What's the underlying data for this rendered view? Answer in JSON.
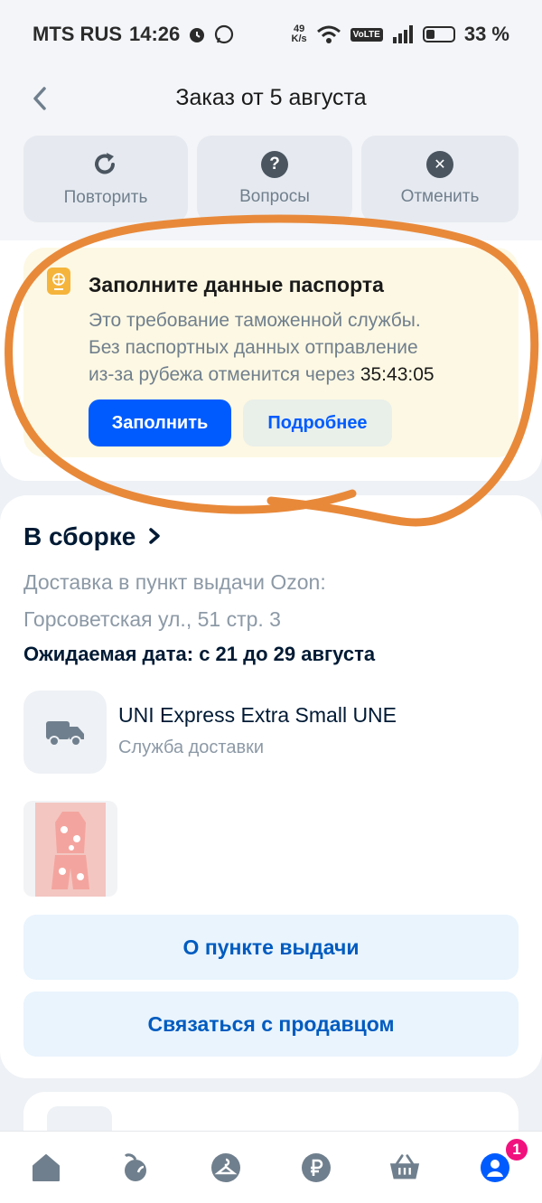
{
  "status_bar": {
    "carrier": "MTS RUS",
    "time": "14:26",
    "net_speed_top": "49",
    "net_speed_bottom": "K/s",
    "volte": "VoLTE",
    "battery_text": "33 %",
    "battery_level": 0.33
  },
  "header": {
    "title": "Заказ от 5 августа"
  },
  "actions": [
    {
      "label": "Повторить",
      "icon": "repeat-icon"
    },
    {
      "label": "Вопросы",
      "icon": "question-icon"
    },
    {
      "label": "Отменить",
      "icon": "cancel-icon"
    }
  ],
  "passport": {
    "title": "Заполните данные паспорта",
    "text_line1": "Это требование таможенной службы.",
    "text_line2": "Без паспортных данных отправление",
    "text_line3": "из-за рубежа отменится через ",
    "timer": "35:43:05",
    "fill_button": "Заполнить",
    "more_button": "Подробнее",
    "annotation_color": "#e8893a"
  },
  "order": {
    "status": "В сборке",
    "delivery_line1": "Доставка в пункт выдачи Ozon:",
    "delivery_line2": "Горсоветская ул., 51 стр. 3",
    "expected": "Ожидаемая дата: с 21 до 29 августа",
    "service_name": "UNI Express Extra Small UNE",
    "service_sub": "Служба доставки",
    "pickup_button": "О пункте выдачи",
    "seller_button": "Связаться с продавцом"
  },
  "tabbar": {
    "items": [
      "home-icon",
      "fresh-icon",
      "wardrobe-icon",
      "finance-icon",
      "cart-icon",
      "profile-icon"
    ],
    "active": "profile-icon",
    "profile_badge": "1",
    "accent": "#005bff",
    "badge_color": "#f1117e"
  }
}
